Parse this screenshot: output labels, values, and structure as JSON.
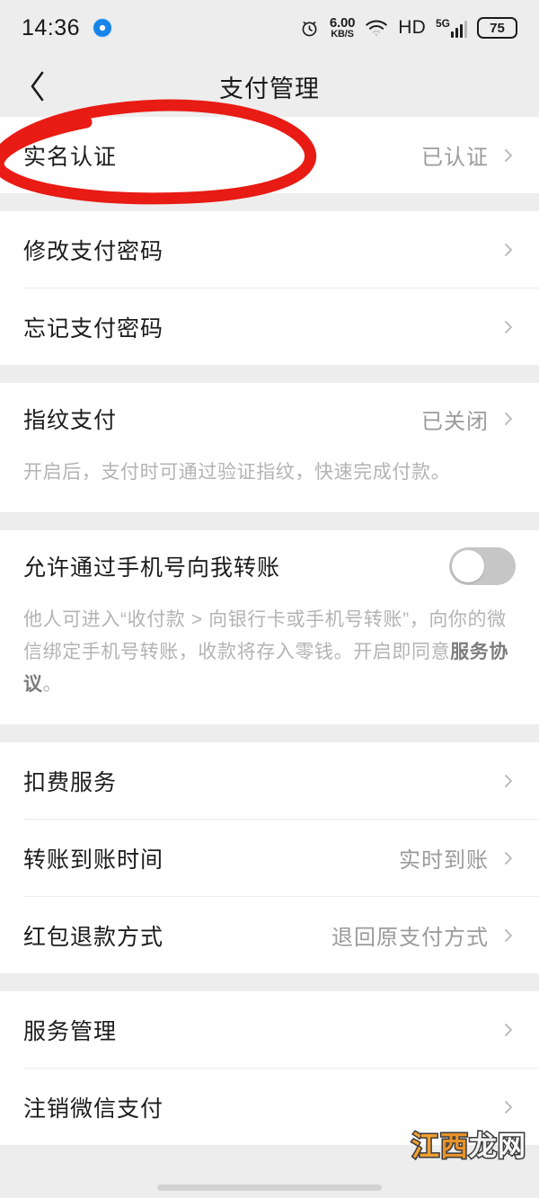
{
  "status_bar": {
    "time": "14:36",
    "dot_icon": "blue-dot-icon",
    "alarm_icon": "alarm-clock-icon",
    "network_speed_value": "6.00",
    "network_speed_unit": "KB/S",
    "wifi_icon": "wifi-icon",
    "hd_label": "HD",
    "signal_label": "5G",
    "battery_level": "75"
  },
  "nav": {
    "back_icon": "back-chevron-icon",
    "title": "支付管理"
  },
  "sections": [
    {
      "rows": [
        {
          "label": "实名认证",
          "value": "已认证",
          "chevron": true
        }
      ]
    },
    {
      "rows": [
        {
          "label": "修改支付密码",
          "value": "",
          "chevron": true
        },
        {
          "label": "忘记支付密码",
          "value": "",
          "chevron": true
        }
      ]
    },
    {
      "rows": [
        {
          "label": "指纹支付",
          "value": "已关闭",
          "chevron": true,
          "desc": "开启后，支付时可通过验证指纹，快速完成付款。"
        }
      ]
    },
    {
      "rows": [
        {
          "label": "允许通过手机号向我转账",
          "toggle": true,
          "toggle_on": false,
          "desc_pre": "他人可进入“收付款 > 向银行卡或手机号转账”，向你的微信绑定手机号转账，收款将存入零钱。开启即同意",
          "desc_link": "服务协议",
          "desc_post": "。"
        }
      ]
    },
    {
      "rows": [
        {
          "label": "扣费服务",
          "value": "",
          "chevron": true
        },
        {
          "label": "转账到账时间",
          "value": "实时到账",
          "chevron": true
        },
        {
          "label": "红包退款方式",
          "value": "退回原支付方式",
          "chevron": true
        }
      ]
    },
    {
      "rows": [
        {
          "label": "服务管理",
          "value": "",
          "chevron": true
        },
        {
          "label": "注销微信支付",
          "value": "",
          "chevron": true
        }
      ]
    }
  ],
  "annotation": {
    "type": "red-ellipse-highlight",
    "target": "实名认证",
    "color": "#e81b15"
  },
  "watermark": {
    "char1": "江",
    "char2": "西",
    "char3": "龙",
    "char4": "网"
  }
}
